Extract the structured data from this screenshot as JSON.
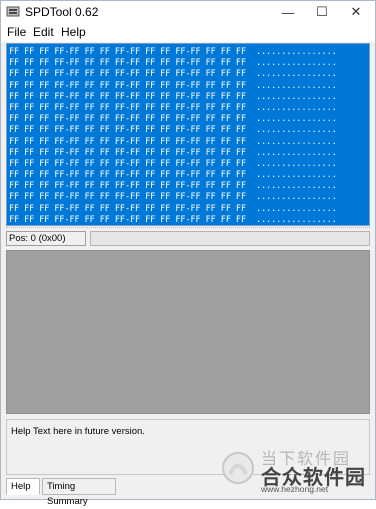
{
  "window": {
    "title": "SPDTool 0.62",
    "controls": {
      "minimize": "—",
      "maximize": "☐",
      "close": "✕"
    }
  },
  "menu": {
    "file": "File",
    "edit": "Edit",
    "help": "Help"
  },
  "hex_view": {
    "rows": [
      "FF FF FF FF-FF FF FF FF-FF FF FF FF-FF FF FF FF  ................",
      "FF FF FF FF-FF FF FF FF-FF FF FF FF-FF FF FF FF  ................",
      "FF FF FF FF-FF FF FF FF-FF FF FF FF-FF FF FF FF  ................",
      "FF FF FF FF-FF FF FF FF-FF FF FF FF-FF FF FF FF  ................",
      "FF FF FF FF-FF FF FF FF-FF FF FF FF-FF FF FF FF  ................",
      "FF FF FF FF-FF FF FF FF-FF FF FF FF-FF FF FF FF  ................",
      "FF FF FF FF-FF FF FF FF-FF FF FF FF-FF FF FF FF  ................",
      "FF FF FF FF-FF FF FF FF-FF FF FF FF-FF FF FF FF  ................",
      "FF FF FF FF-FF FF FF FF-FF FF FF FF-FF FF FF FF  ................",
      "FF FF FF FF-FF FF FF FF-FF FF FF FF-FF FF FF FF  ................",
      "FF FF FF FF-FF FF FF FF-FF FF FF FF-FF FF FF FF  ................",
      "FF FF FF FF-FF FF FF FF-FF FF FF FF-FF FF FF FF  ................",
      "FF FF FF FF-FF FF FF FF-FF FF FF FF-FF FF FF FF  ................",
      "FF FF FF FF-FF FF FF FF-FF FF FF FF-FF FF FF FF  ................",
      "FF FF FF FF-FF FF FF FF-FF FF FF FF-FF FF FF FF  ................",
      "FF FF FF FF-FF FF FF FF-FF FF FF FF-FF FF FF FF  ................"
    ],
    "selection_color": "#0078d7"
  },
  "status": {
    "position": "Pos: 0 (0x00)"
  },
  "help_panel": {
    "text": "Help Text here in future version."
  },
  "tabs": [
    {
      "label": "Help",
      "active": true
    },
    {
      "label": "Timing Summary",
      "active": false
    }
  ],
  "watermark": {
    "top_text": "当下软件园",
    "main_text": "合众软件园",
    "url": "www.hezhong.net"
  }
}
